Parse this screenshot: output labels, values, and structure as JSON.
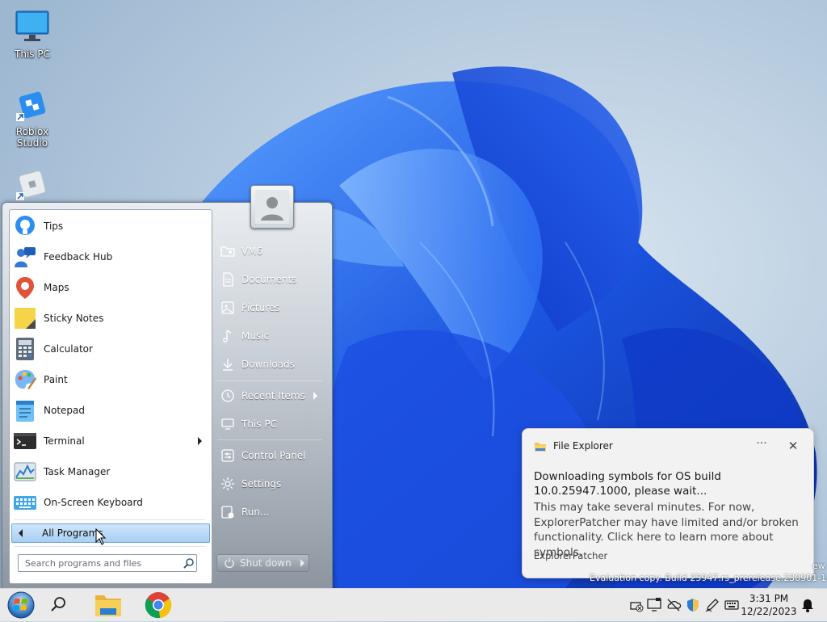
{
  "desktop": {
    "icons": [
      {
        "label": "This PC",
        "icon": "monitor-icon"
      },
      {
        "label": "Roblox Studio",
        "icon": "roblox-studio-icon"
      },
      {
        "label": "",
        "icon": "roblox-player-icon"
      }
    ]
  },
  "start_menu": {
    "programs": [
      {
        "label": "Tips",
        "icon": "tips-icon"
      },
      {
        "label": "Feedback Hub",
        "icon": "feedback-hub-icon"
      },
      {
        "label": "Maps",
        "icon": "maps-icon"
      },
      {
        "label": "Sticky Notes",
        "icon": "sticky-notes-icon"
      },
      {
        "label": "Calculator",
        "icon": "calculator-icon"
      },
      {
        "label": "Paint",
        "icon": "paint-icon"
      },
      {
        "label": "Notepad",
        "icon": "notepad-icon"
      },
      {
        "label": "Terminal",
        "icon": "terminal-icon",
        "submenu": true
      },
      {
        "label": "Task Manager",
        "icon": "task-manager-icon"
      },
      {
        "label": "On-Screen Keyboard",
        "icon": "keyboard-icon"
      }
    ],
    "all_programs_label": "All Programs",
    "search_placeholder": "Search programs and files",
    "right_links": [
      {
        "label": "VM6",
        "icon": "user-folder-icon"
      },
      {
        "label": "Documents",
        "icon": "documents-icon"
      },
      {
        "label": "Pictures",
        "icon": "pictures-icon"
      },
      {
        "label": "Music",
        "icon": "music-icon"
      },
      {
        "label": "Downloads",
        "icon": "downloads-icon"
      },
      {
        "label": "Recent Items",
        "icon": "recent-items-icon",
        "submenu": true
      },
      {
        "label": "This PC",
        "icon": "this-pc-icon"
      },
      {
        "label": "Control Panel",
        "icon": "control-panel-icon"
      },
      {
        "label": "Settings",
        "icon": "settings-icon"
      },
      {
        "label": "Run...",
        "icon": "run-icon"
      }
    ],
    "shutdown_label": "Shut down"
  },
  "notification": {
    "app_name": "File Explorer",
    "title_text": "Downloading symbols for OS build 10.0.25947.1000, please wait...",
    "body_text": "This may take several minutes. For now, ExplorerPatcher may have limited and/or broken functionality. Click here to learn more about symbols.",
    "attribution": "ExplorerPatcher",
    "more_label": "···",
    "close_label": "✕"
  },
  "watermark": {
    "line": "Evaluation copy. Build 25947.rs_prerelease.230901-1416",
    "partial": "ew"
  },
  "taskbar": {
    "time": "3:31 PM",
    "date": "12/22/2023",
    "pinned": [
      "start-orb-icon",
      "search-icon",
      "file-explorer-icon",
      "chrome-icon"
    ],
    "tray": [
      "network-disconnected-icon",
      "display-icon",
      "onedrive-icon",
      "windows-security-icon",
      "pen-icon",
      "keyboard-layout-icon",
      "notification-bell-icon"
    ]
  },
  "colors": {
    "accent": "#1f6fd8",
    "toast_bg": "#f2f2f2",
    "taskbar_bg": "#eaeaea"
  }
}
